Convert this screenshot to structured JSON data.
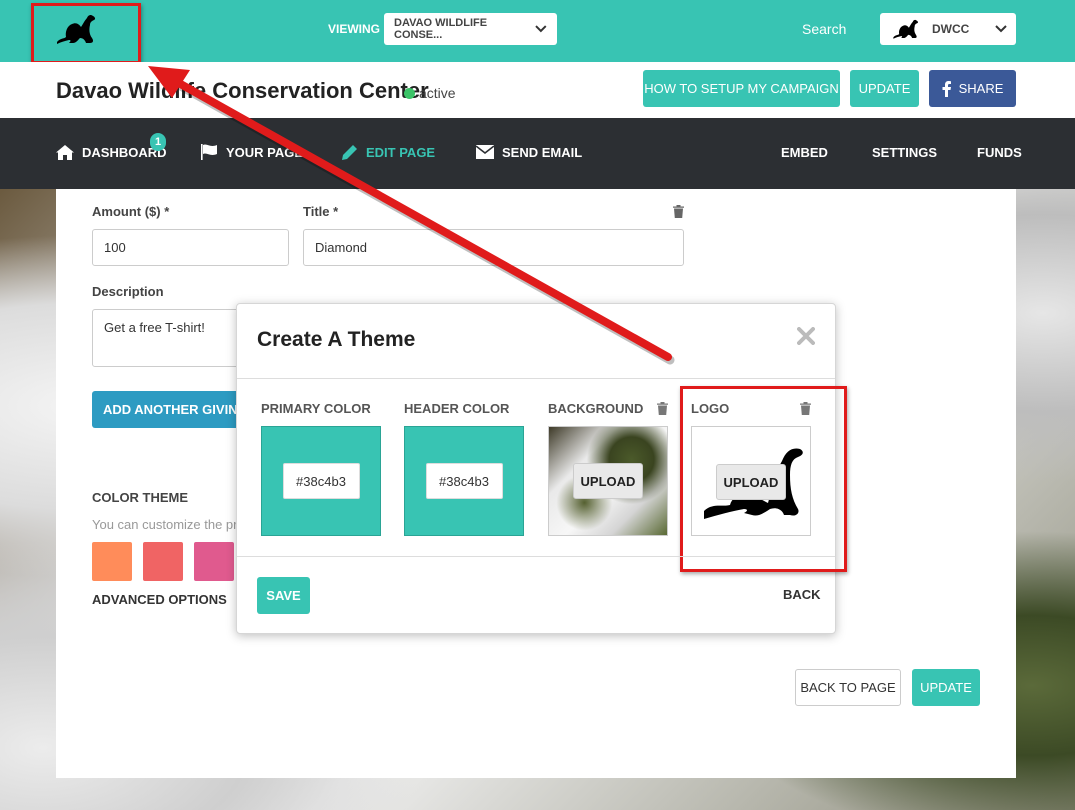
{
  "topbar": {
    "viewing_label": "VIEWING",
    "viewing_select": "DAVAO WILDLIFE CONSE...",
    "search_label": "Search",
    "account_select": "DWCC"
  },
  "header": {
    "title": "Davao Wildlife Conservation Center",
    "status": "active",
    "setup_button": "HOW TO SETUP MY CAMPAIGN",
    "update_button": "UPDATE",
    "share_button": "SHARE"
  },
  "nav": {
    "items": [
      {
        "label": "DASHBOARD",
        "badge": "1"
      },
      {
        "label": "YOUR PAGE"
      },
      {
        "label": "EDIT PAGE"
      },
      {
        "label": "SEND EMAIL"
      },
      {
        "label": "EMBED"
      },
      {
        "label": "SETTINGS"
      },
      {
        "label": "FUNDS"
      }
    ]
  },
  "form": {
    "amount_label": "Amount ($) *",
    "amount_value": "100",
    "title_label": "Title *",
    "title_value": "Diamond",
    "description_label": "Description",
    "description_value": "Get a free T-shirt!",
    "add_level_button": "ADD ANOTHER GIVING L",
    "color_theme_label": "COLOR THEME",
    "color_theme_help": "You can customize the pri",
    "swatches": [
      "#ff8c5a",
      "#f06464",
      "#e05a8e"
    ],
    "advanced_options": "ADVANCED OPTIONS",
    "back_to_page_button": "BACK TO PAGE",
    "update_button": "UPDATE"
  },
  "modal": {
    "title": "Create A Theme",
    "primary_color_label": "PRIMARY COLOR",
    "primary_color_value": "#38c4b3",
    "header_color_label": "HEADER COLOR",
    "header_color_value": "#38c4b3",
    "background_label": "BACKGROUND",
    "logo_label": "LOGO",
    "upload_button": "UPLOAD",
    "save_button": "SAVE",
    "back_button": "BACK"
  },
  "colors": {
    "teal": "#38c4b3",
    "dark_nav": "#2c2f33",
    "facebook": "#3b5998",
    "blue_button": "#2d9bc2",
    "highlight_red": "#e01b1b",
    "active_green": "#3cc468"
  }
}
